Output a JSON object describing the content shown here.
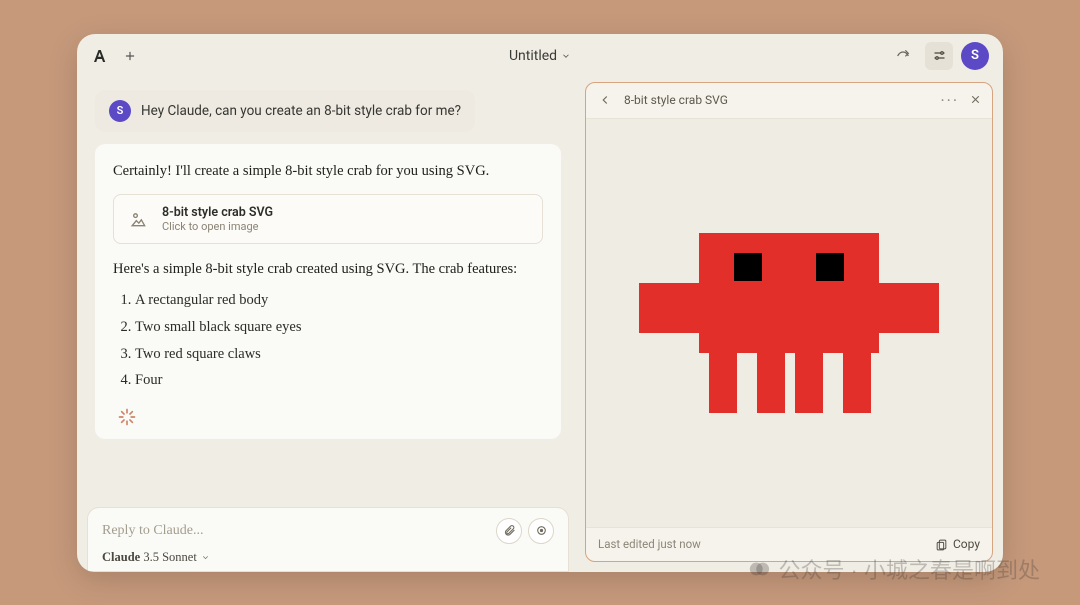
{
  "topbar": {
    "title": "Untitled",
    "avatar_initial": "S"
  },
  "user": {
    "initial": "S",
    "message": "Hey Claude, can you create an 8-bit style crab for me?"
  },
  "assistant": {
    "intro": "Certainly! I'll create a simple 8-bit style crab for you using SVG.",
    "outro": "Here's a simple 8-bit style crab created using SVG. The crab features:",
    "features": [
      "A rectangular red body",
      "Two small black square eyes",
      "Two red square claws",
      "Four"
    ]
  },
  "artifact_card": {
    "title": "8-bit style crab SVG",
    "subtext": "Click to open image"
  },
  "reply": {
    "placeholder": "Reply to Claude...",
    "model_prefix": "Claude",
    "model_name": "3.5 Sonnet"
  },
  "artifact_panel": {
    "title": "8-bit style crab SVG",
    "last_edited": "Last edited just now",
    "copy_label": "Copy"
  },
  "crab": {
    "color": "#e22f29",
    "eye_color": "#000000"
  },
  "watermark": "公众号 · 小城之春是啊到处"
}
